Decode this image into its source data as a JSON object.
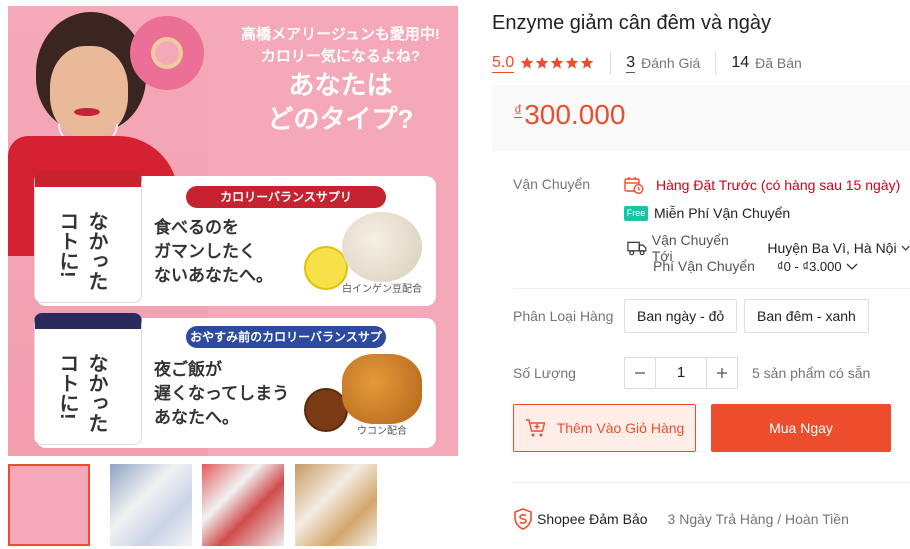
{
  "gallery": {
    "main_image": {
      "headline_small": "高橋メアリージュンも愛用中!\nカロリー気になるよね?",
      "headline_big": "あなたは\nどのタイプ?",
      "box1_band": "カロリーバランスサプリ",
      "box1_copy": "食べるのを\nガマンしたく\nないあなたへ。",
      "box2_band": "おやすみ前のカロリーバランスサプリ",
      "box2_copy": "夜ご飯が\n遅くなってしまう\nあなたへ。",
      "pack_text": "なかったコトに!",
      "box1_extra": "白インゲン豆配合",
      "box2_extra": "ウコン配合"
    },
    "thumbnails": [
      {
        "label": "thumb-1",
        "active": true
      },
      {
        "label": "thumb-2",
        "active": false
      },
      {
        "label": "thumb-3",
        "active": false
      },
      {
        "label": "thumb-4",
        "active": false
      }
    ]
  },
  "product": {
    "title": "Enzyme giảm cân đêm và ngày",
    "rating": "5.0",
    "stars": 5,
    "reviews_count": "3",
    "reviews_label": "Đánh Giá",
    "sold_count": "14",
    "sold_label": "Đã Bán",
    "currency": "₫",
    "price": "300.000"
  },
  "shipping": {
    "label": "Vận Chuyển",
    "preorder": "Hàng Đặt Trước (có hàng sau 15 ngày)",
    "free_badge": "Free",
    "free_shipping": "Miễn Phí Vận Chuyển",
    "to_label": "Vận Chuyển Tới",
    "to_value": "Huyện Ba Vì, Hà Nội",
    "fee_label": "Phí Vận Chuyển",
    "fee_value": "₫0 - ₫3.000"
  },
  "variants": {
    "label": "Phân Loại Hàng",
    "options": [
      "Ban ngày - đỏ",
      "Ban đêm - xanh"
    ]
  },
  "quantity": {
    "label": "Số Lượng",
    "value": "1",
    "stock": "5 sản phẩm có sẵn"
  },
  "actions": {
    "add_to_cart": "Thêm Vào Giỏ Hàng",
    "buy_now": "Mua Ngay"
  },
  "guarantee": {
    "brand": "Shopee Đảm Bảo",
    "policy": "3 Ngày Trả Hàng / Hoàn Tiền"
  },
  "colors": {
    "accent": "#ee4d2d",
    "preorder": "#d0011b",
    "free_badge": "#1bc4a5"
  }
}
